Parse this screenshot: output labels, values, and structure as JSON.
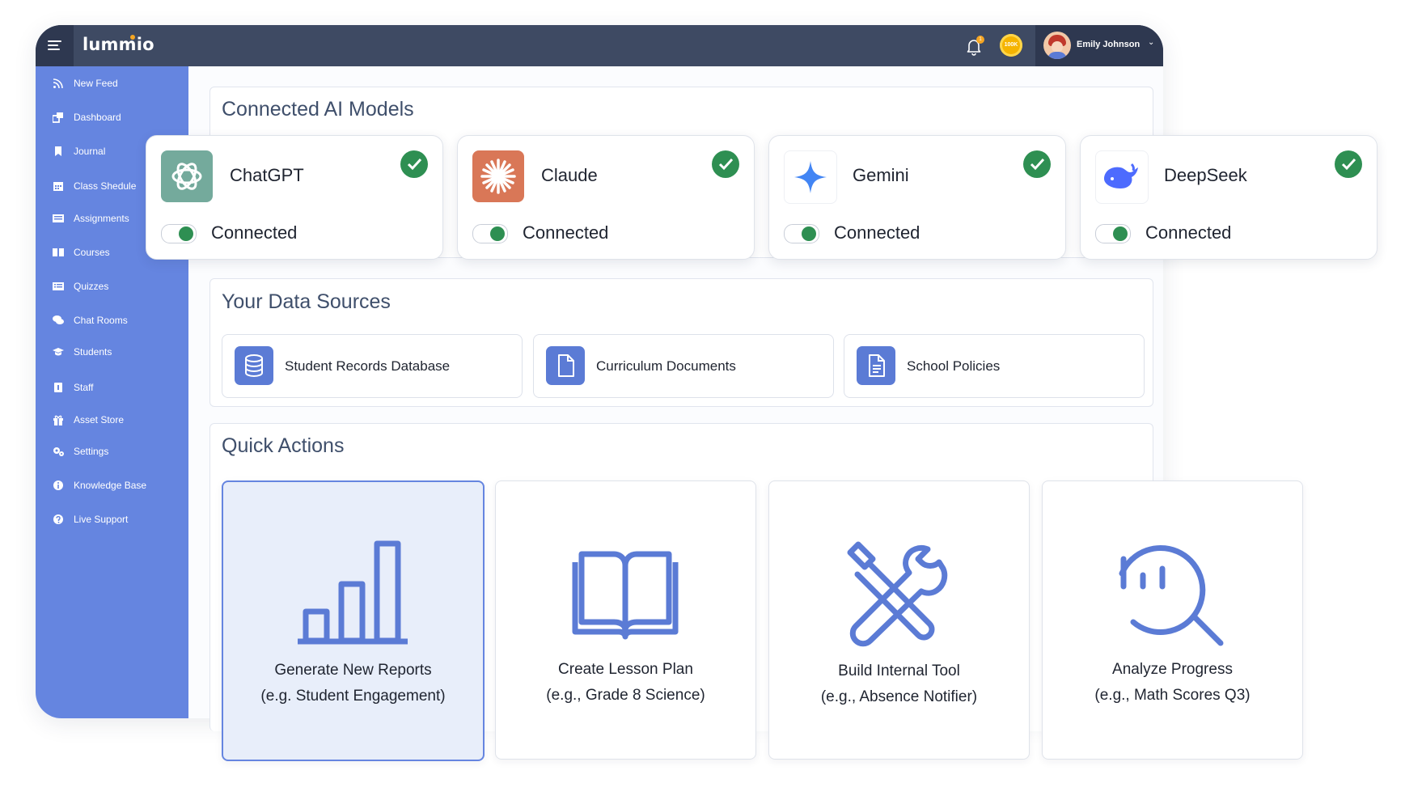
{
  "app": {
    "logo": "lummio"
  },
  "header": {
    "notification_count": "1",
    "coins_label": "100K",
    "user_name": "Emily Johnson"
  },
  "sidebar": {
    "items": [
      {
        "label": "New Feed",
        "icon": "rss-icon"
      },
      {
        "label": "Dashboard",
        "icon": "dashboard-icon"
      },
      {
        "label": "Journal",
        "icon": "bookmark-icon"
      },
      {
        "label": "Class Shedule",
        "icon": "calendar-icon"
      },
      {
        "label": "Assignments",
        "icon": "list-icon"
      },
      {
        "label": "Courses",
        "icon": "open-book-icon"
      },
      {
        "label": "Quizzes",
        "icon": "quiz-list-icon"
      },
      {
        "label": "Chat Rooms",
        "icon": "chat-icon"
      },
      {
        "label": "Students",
        "icon": "graduation-cap-icon"
      },
      {
        "label": "Staff",
        "icon": "id-badge-icon"
      },
      {
        "label": "Asset Store",
        "icon": "gift-icon"
      },
      {
        "label": "Settings",
        "icon": "gears-icon"
      },
      {
        "label": "Knowledge Base",
        "icon": "info-icon"
      },
      {
        "label": "Live Support",
        "icon": "help-icon"
      }
    ]
  },
  "models": {
    "title": "Connected AI Models",
    "items": [
      {
        "name": "ChatGPT",
        "status": "Connected",
        "color": "#74aa9c"
      },
      {
        "name": "Claude",
        "status": "Connected",
        "color": "#d97757"
      },
      {
        "name": "Gemini",
        "status": "Connected",
        "color": "#4285f4"
      },
      {
        "name": "DeepSeek",
        "status": "Connected",
        "color": "#4d6bfe"
      }
    ]
  },
  "sources": {
    "title": "Your Data Sources",
    "items": [
      {
        "label": "Student Records Database",
        "icon": "database-icon"
      },
      {
        "label": "Curriculum Documents",
        "icon": "document-icon"
      },
      {
        "label": "School Policies",
        "icon": "policy-document-icon"
      }
    ]
  },
  "actions": {
    "title": "Quick Actions",
    "items": [
      {
        "title": "Generate New Reports",
        "subtitle": "(e.g. Student Engagement)",
        "icon": "bar-chart-icon"
      },
      {
        "title": "Create Lesson Plan",
        "subtitle": "(e.g., Grade 8 Science)",
        "icon": "book-icon"
      },
      {
        "title": "Build Internal Tool",
        "subtitle": "(e.g., Absence Notifier)",
        "icon": "tools-icon"
      },
      {
        "title": "Analyze Progress",
        "subtitle": "(e.g., Math Scores Q3)",
        "icon": "analytics-search-icon"
      }
    ]
  },
  "colors": {
    "accent": "#6585e0",
    "header": "#3e4a63",
    "success": "#2e8f52"
  }
}
